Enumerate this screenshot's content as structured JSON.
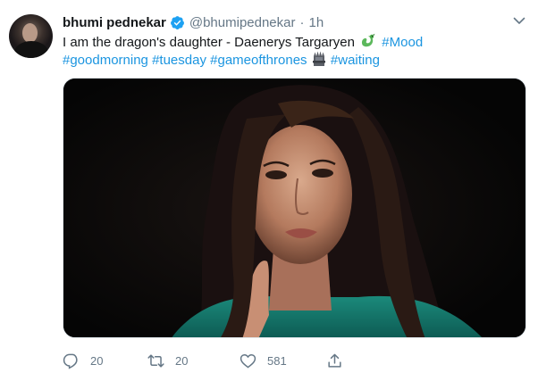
{
  "tweet": {
    "author": {
      "display_name": "bhumi pednekar",
      "handle": "@bhumipednekar",
      "verified": true,
      "avatar": "avatar-photo"
    },
    "separator": "·",
    "time": "1h",
    "text": {
      "line1_plain": "I am the dragon's daughter - Daenerys Targaryen",
      "line1_emoji": "dragon-emoji",
      "line1_hashtag": "#Mood",
      "line2_hashtags": [
        "#goodmorning",
        "#tuesday",
        "#gameofthrones"
      ],
      "line2_emoji": "throne-emoji",
      "line2_last_hashtag": "#waiting"
    },
    "media": {
      "type": "photo",
      "alt": "portrait-photo"
    },
    "actions": {
      "reply": {
        "icon": "reply-icon",
        "count": "20"
      },
      "retweet": {
        "icon": "retweet-icon",
        "count": "20"
      },
      "like": {
        "icon": "heart-icon",
        "count": "581"
      },
      "share": {
        "icon": "share-icon"
      }
    },
    "menu_icon": "chevron-down-icon",
    "colors": {
      "link": "#1b95e0",
      "verified": "#1da1f2",
      "muted": "#657786",
      "text": "#14171a"
    }
  }
}
